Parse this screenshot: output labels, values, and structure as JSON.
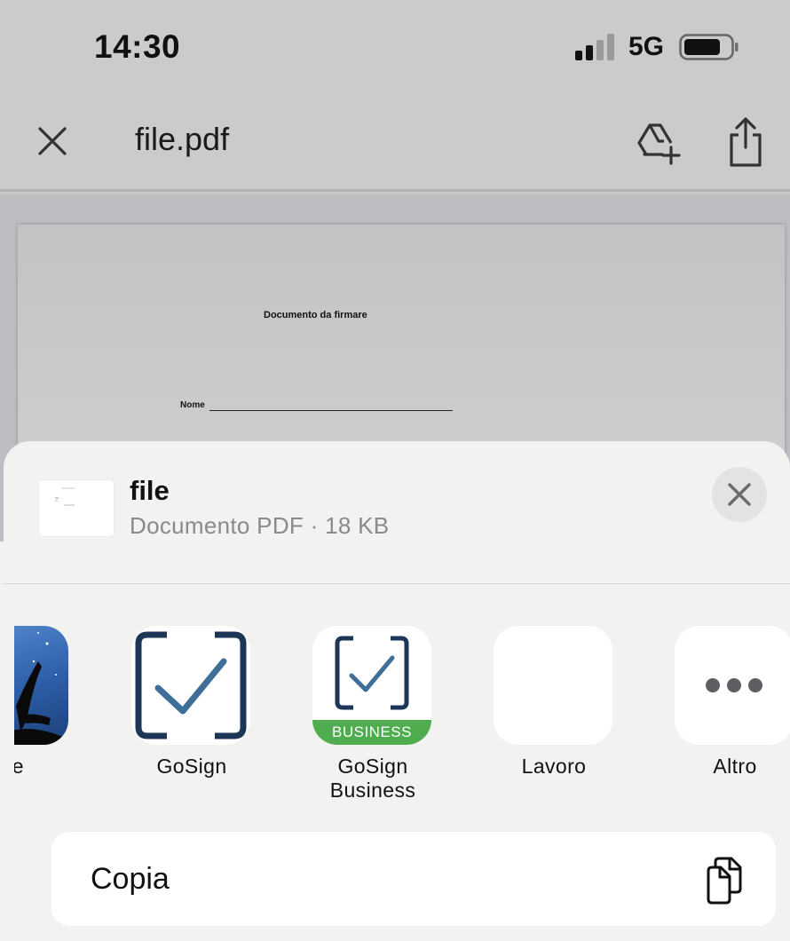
{
  "status_bar": {
    "time": "14:30",
    "network": "5G",
    "signal_bars_active": 2,
    "signal_bars_total": 4,
    "battery_level": 0.8
  },
  "nav": {
    "title": "file.pdf",
    "close_icon": "close-icon",
    "drive_icon": "add-to-drive-icon",
    "share_icon": "share-icon"
  },
  "document": {
    "heading": "Documento da firmare",
    "name_label": "Nome"
  },
  "share_sheet": {
    "file_title": "file",
    "file_subtitle": "Documento PDF · 18 KB",
    "apps": [
      {
        "label": "dle",
        "icon": "kindle-icon"
      },
      {
        "label": "GoSign",
        "icon": "gosign-icon"
      },
      {
        "label": "GoSign\nBusiness",
        "icon": "gosign-business-icon",
        "badge": "BUSINESS"
      },
      {
        "label": "Lavoro",
        "icon": "lavoro-icon"
      },
      {
        "label": "Altro",
        "icon": "more-icon"
      }
    ],
    "actions": [
      {
        "label": "Copia",
        "icon": "copy-icon"
      }
    ]
  },
  "colors": {
    "gosign_navy": "#1d3557",
    "gosign_check": "#3d6f98",
    "business_green": "#4fad50",
    "sheet_bg": "#f2f2f1"
  }
}
